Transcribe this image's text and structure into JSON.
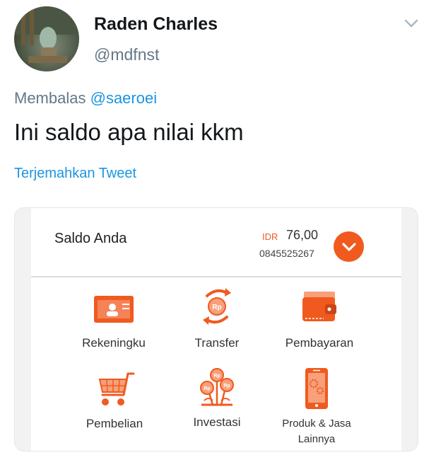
{
  "tweet": {
    "display_name": "Raden Charles",
    "handle": "@mdfnst",
    "reply_prefix": "Membalas",
    "reply_to": "@saeroei",
    "text": "Ini saldo apa nilai kkm",
    "translate_link": "Terjemahkan Tweet"
  },
  "balance_card": {
    "label": "Saldo Anda",
    "currency": "IDR",
    "amount": "76,00",
    "account_number": "0845525267",
    "accent_color": "#f05a1f"
  },
  "menu": [
    {
      "label": "Rekeningku",
      "icon": "account-card-icon"
    },
    {
      "label": "Transfer",
      "icon": "transfer-icon"
    },
    {
      "label": "Pembayaran",
      "icon": "wallet-icon"
    },
    {
      "label": "Pembelian",
      "icon": "shopping-cart-icon"
    },
    {
      "label": "Investasi",
      "icon": "investment-icon"
    },
    {
      "label_line1": "Produk & Jasa",
      "label_line2": "Lainnya",
      "icon": "phone-services-icon"
    }
  ]
}
